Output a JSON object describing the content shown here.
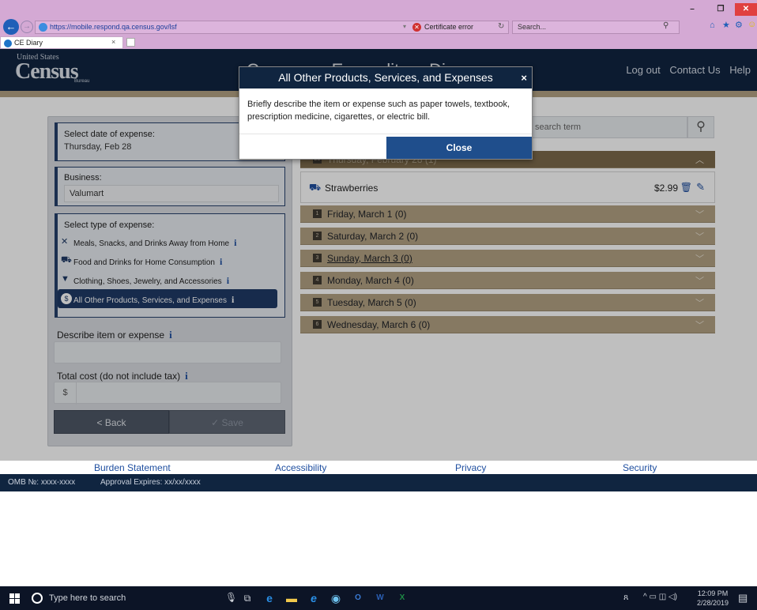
{
  "browser": {
    "url": "https://mobile.respond.qa.census.gov/lsf",
    "cert_error": "Certificate error",
    "search_placeholder": "Search...",
    "tab_title": "CE Diary",
    "tab_close": "×"
  },
  "header": {
    "logo_top": "United States",
    "logo_main": "Census",
    "logo_bottom": "Bureau",
    "title": "Consumer Expenditure Diary",
    "links": [
      "Log out",
      "Contact Us",
      "Help"
    ]
  },
  "form": {
    "date_label": "Select date of expense:",
    "date_value": "Thursday, Feb 28",
    "business_label": "Business:",
    "business_value": "Valumart",
    "type_label": "Select type of expense:",
    "types": [
      {
        "label": "Meals, Snacks, and Drinks Away from Home",
        "icon": "utensils-icon",
        "glyph": "✕"
      },
      {
        "label": "Food and Drinks for Home Consumption",
        "icon": "shopping-cart-icon",
        "glyph": "🛒"
      },
      {
        "label": "Clothing, Shoes, Jewelry, and Accessories",
        "icon": "shirt-icon",
        "glyph": "👕"
      },
      {
        "label": "All Other Products, Services, and Expenses",
        "icon": "dollar-icon",
        "glyph": "$"
      }
    ],
    "describe_label": "Describe item or expense",
    "cost_label": "Total cost (do not include tax)",
    "currency": "$",
    "back_label": "< Back",
    "save_label": "✓ Save",
    "info_glyph": "i"
  },
  "diary": {
    "search_placeholder": "search term",
    "days": [
      {
        "label": "Thursday, February 28 (1)",
        "num": "28",
        "open": true
      },
      {
        "label": "Friday, March 1 (0)",
        "num": "1",
        "open": false
      },
      {
        "label": "Saturday, March 2 (0)",
        "num": "2",
        "open": false
      },
      {
        "label": "Sunday, March 3 (0)",
        "num": "3",
        "open": false
      },
      {
        "label": "Monday, March 4 (0)",
        "num": "4",
        "open": false
      },
      {
        "label": "Tuesday, March 5 (0)",
        "num": "5",
        "open": false
      },
      {
        "label": "Wednesday, March 6 (0)",
        "num": "6",
        "open": false
      }
    ],
    "item": {
      "name": "Strawberries",
      "price": "$2.99"
    }
  },
  "modal": {
    "title": "All Other Products, Services, and Expenses",
    "close_x": "×",
    "body": "Briefly describe the item or expense such as paper towels, textbook, prescription medicine, cigarettes, or electric bill.",
    "close_label": "Close"
  },
  "footer": {
    "links": [
      "Burden Statement",
      "Accessibility",
      "Privacy",
      "Security"
    ],
    "omb": "OMB №: xxxx-xxxx",
    "approval": "Approval Expires: xx/xx/xxxx"
  },
  "taskbar": {
    "search_placeholder": "Type here to search",
    "time": "12:09 PM",
    "date": "2/28/2019"
  },
  "colors": {
    "navy": "#102540",
    "gold": "#b3a283",
    "accent_blue": "#1f4e8c"
  }
}
